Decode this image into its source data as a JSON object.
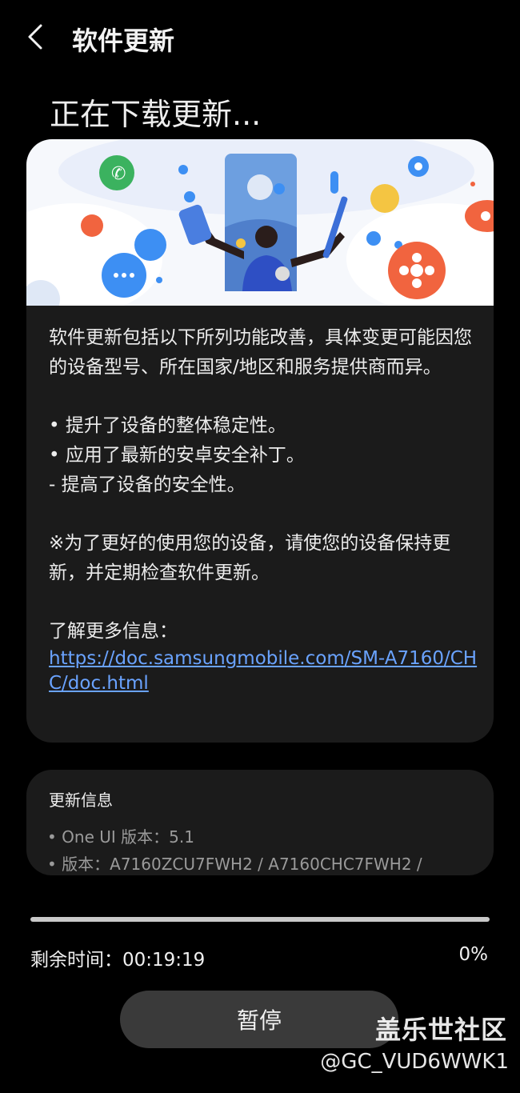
{
  "header": {
    "back_icon": "chevron-left-icon",
    "title": "软件更新"
  },
  "page_title": "正在下载更新...",
  "description": {
    "intro": "软件更新包括以下所列功能改善，具体变更可能因您的设备型号、所在国家/地区和服务提供商而异。",
    "bullets": [
      "• 提升了设备的整体稳定性。",
      "• 应用了最新的安卓安全补丁。",
      " - 提高了设备的安全性。"
    ],
    "note": "※为了更好的使用您的设备，请使您的设备保持更新，并定期检查软件更新。",
    "more_info_label": "了解更多信息：",
    "more_info_link": "https://doc.samsungmobile.com/SM-A7160/CHC/doc.html"
  },
  "update_info": {
    "title": "更新信息",
    "lines": [
      "• One UI 版本：5.1",
      "• 版本：A7160ZCU7FWH2 / A7160CHC7FWH2 /"
    ]
  },
  "progress": {
    "percent_value": 0,
    "remaining_label": "剩余时间：00:19:19",
    "percent_label": "0%"
  },
  "pause_button": "暂停",
  "watermark": {
    "brand": "盖乐世社区",
    "user": "@GC_VUD6WWK1"
  },
  "colors": {
    "background": "#000000",
    "card": "#1b1b1b",
    "link": "#6aa3ff",
    "progress_track": "#c9c9c9",
    "progress_fill": "#3e91ff",
    "button": "#3a3a3a"
  }
}
